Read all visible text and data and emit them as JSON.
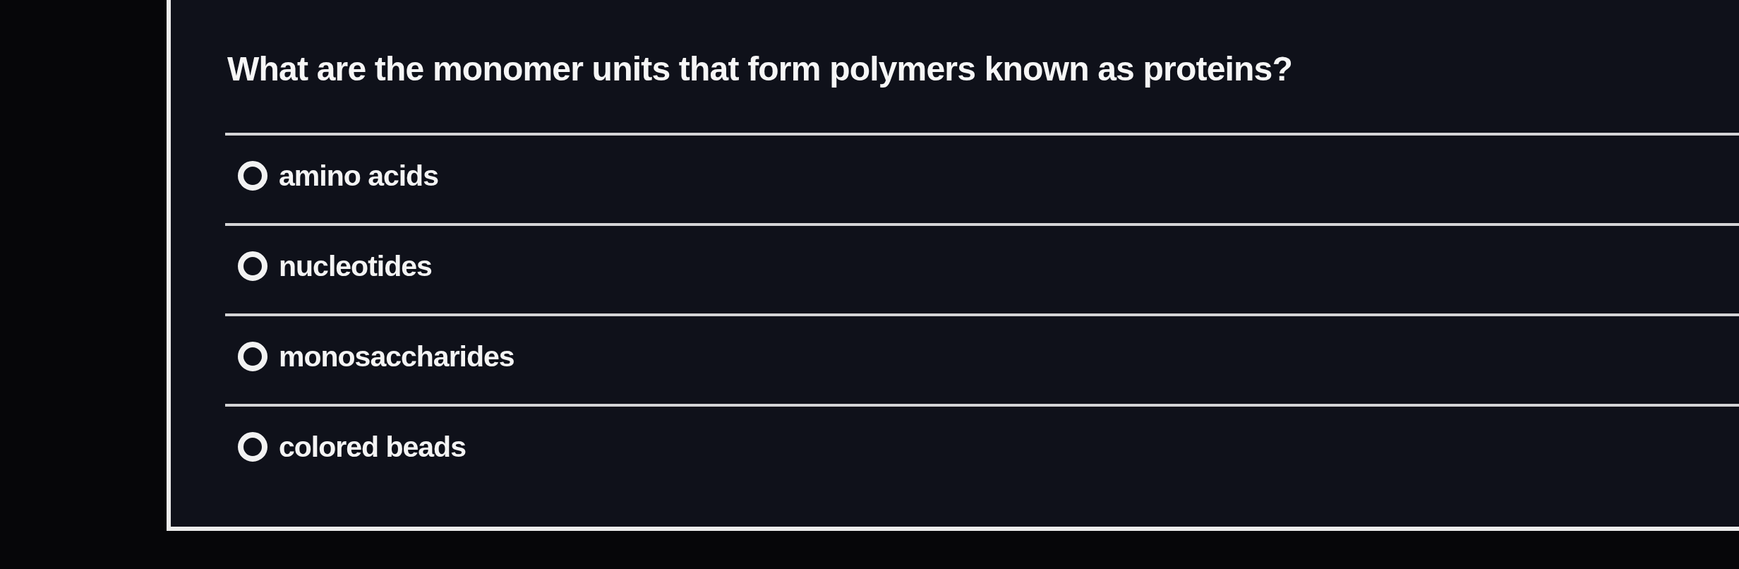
{
  "question": "What are the monomer units that form polymers known as proteins?",
  "options": [
    {
      "label": "amino acids",
      "selected": false
    },
    {
      "label": "nucleotides",
      "selected": false
    },
    {
      "label": "monosaccharides",
      "selected": false
    },
    {
      "label": "colored beads",
      "selected": false
    }
  ]
}
